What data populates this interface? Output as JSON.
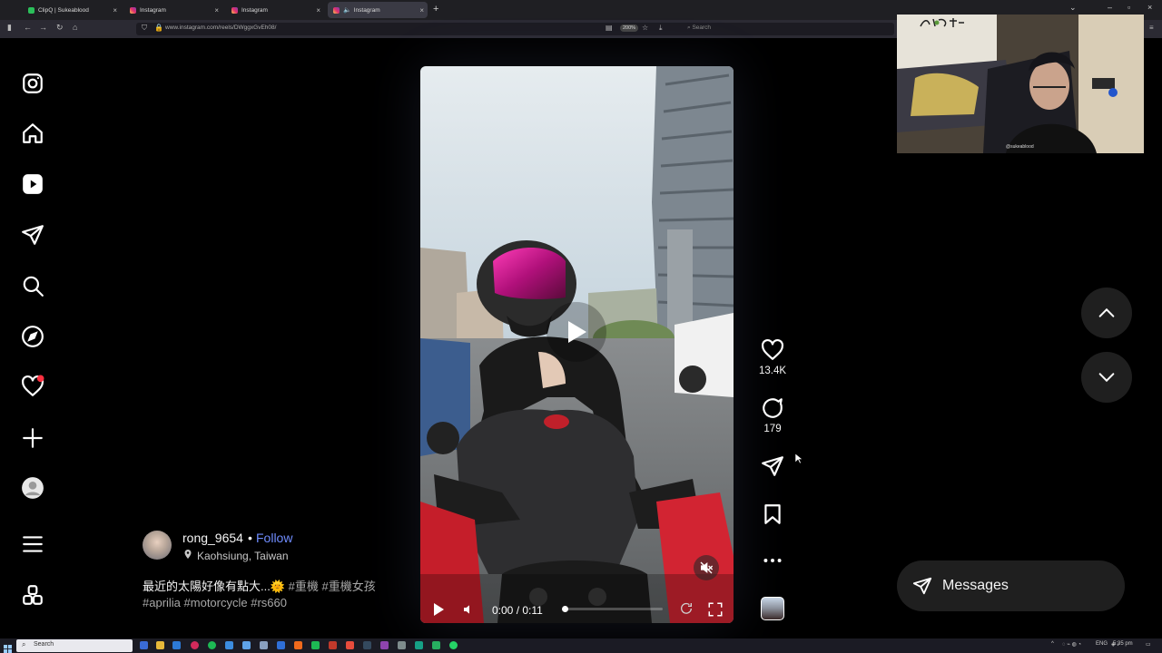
{
  "browser": {
    "tabs": [
      {
        "title": "ClipQ | Sukeablood",
        "active": false
      },
      {
        "title": "Instagram",
        "active": false
      },
      {
        "title": "Instagram",
        "active": false
      },
      {
        "title": "Instagram",
        "active": true
      }
    ],
    "url": "www.instagram.com/reels/DWggxGvEh08/",
    "zoom": "200%",
    "search_placeholder": "Search"
  },
  "sidebar": {
    "items": [
      {
        "icon": "instagram-logo-icon"
      },
      {
        "icon": "home-icon"
      },
      {
        "icon": "reels-icon"
      },
      {
        "icon": "direct-send-icon"
      },
      {
        "icon": "search-icon"
      },
      {
        "icon": "explore-compass-icon"
      },
      {
        "icon": "notifications-heart-icon",
        "badge": true
      },
      {
        "icon": "create-plus-icon"
      },
      {
        "icon": "profile-icon"
      },
      {
        "icon": "more-menu-icon"
      },
      {
        "icon": "also-from-meta-icon"
      }
    ]
  },
  "reel": {
    "time": "0:00 / 0:11",
    "progress": 0.0,
    "muted": true
  },
  "actions": {
    "likes": "13.4K",
    "comments": "179"
  },
  "post": {
    "username": "rong_9654",
    "separator": "•",
    "follow_label": "Follow",
    "location": "Kaohsiung, Taiwan",
    "caption_text": "最近的太陽好像有點大...🌞",
    "caption_tags": "#重機 #重機女孩 #aprilia #motorcycle #rs660"
  },
  "messages": {
    "label": "Messages"
  },
  "webcam": {
    "overlay_tag": "@sukeablood"
  },
  "taskbar": {
    "search_placeholder": "Search",
    "lang": "ENG",
    "clock": "5:35 pm"
  },
  "colors": {
    "background": "#000000",
    "link_blue": "#708dff",
    "notification_red": "#ff3040"
  }
}
